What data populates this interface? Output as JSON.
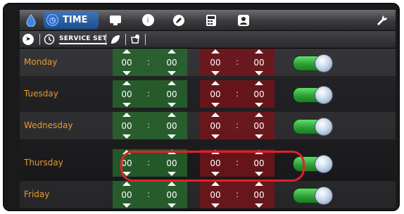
{
  "tabs": {
    "active_label": "TIME",
    "icons": [
      "water-drop-icon",
      "clock-icon",
      "monitor-icon",
      "info-icon",
      "pencil-icon",
      "calculator-icon",
      "user-icon",
      "wrench-icon"
    ]
  },
  "subbar": {
    "service_set_label": "SERVICE SET",
    "icons": [
      "play-icon",
      "clock-settings-icon",
      "leaf-icon",
      "cup-clock-icon"
    ]
  },
  "schedule": [
    {
      "day": "Monday",
      "on_h": "00",
      "on_m": "00",
      "off_h": "00",
      "off_m": "00",
      "enabled": true
    },
    {
      "day": "Tuesday",
      "on_h": "00",
      "on_m": "00",
      "off_h": "00",
      "off_m": "00",
      "enabled": true
    },
    {
      "day": "Wednesday",
      "on_h": "00",
      "on_m": "00",
      "off_h": "00",
      "off_m": "00",
      "enabled": true
    },
    {
      "day": "Thursday",
      "on_h": "00",
      "on_m": "00",
      "off_h": "00",
      "off_m": "00",
      "enabled": true
    },
    {
      "day": "Friday",
      "on_h": "00",
      "on_m": "00",
      "off_h": "00",
      "off_m": "00",
      "enabled": true
    }
  ],
  "separator": ":",
  "colors": {
    "accent": "#1c4f92",
    "day_text": "#e79a2c",
    "on_block": "#286e2d",
    "off_block": "#78141a",
    "toggle": "#2c9a35",
    "highlight": "#e1202c"
  }
}
